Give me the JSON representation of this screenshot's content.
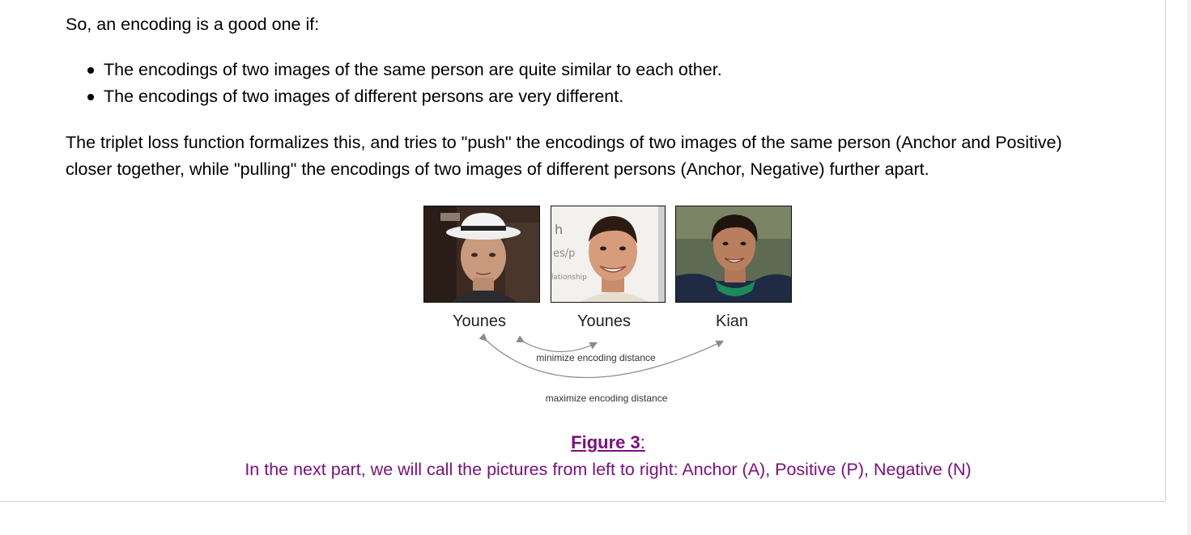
{
  "intro": "So, an encoding is a good one if:",
  "bullets": [
    "The encodings of two images of the same person are quite similar to each other.",
    "The encodings of two images of different persons are very different."
  ],
  "paragraph": {
    "line1": "The triplet loss function formalizes this, and tries to \"push\" the encodings of two images of the same person (Anchor and Positive)",
    "line2": "closer together, while \"pulling\" the encodings of two images of different persons (Anchor, Negative) further apart."
  },
  "figure": {
    "names": [
      "Younes",
      "Younes",
      "Kian"
    ],
    "minimize_label": "minimize encoding distance",
    "maximize_label": "maximize encoding distance",
    "whiteboard_text": [
      "h",
      "es/p",
      "lationship"
    ],
    "title": "Figure 3",
    "title_colon": ":",
    "caption": "In the next part, we will call the pictures from left to right: Anchor (A), Positive (P), Negative (N)"
  },
  "colors": {
    "caption": "#7a0f7f",
    "text": "#000000",
    "arrow": "#8a8a8a"
  }
}
